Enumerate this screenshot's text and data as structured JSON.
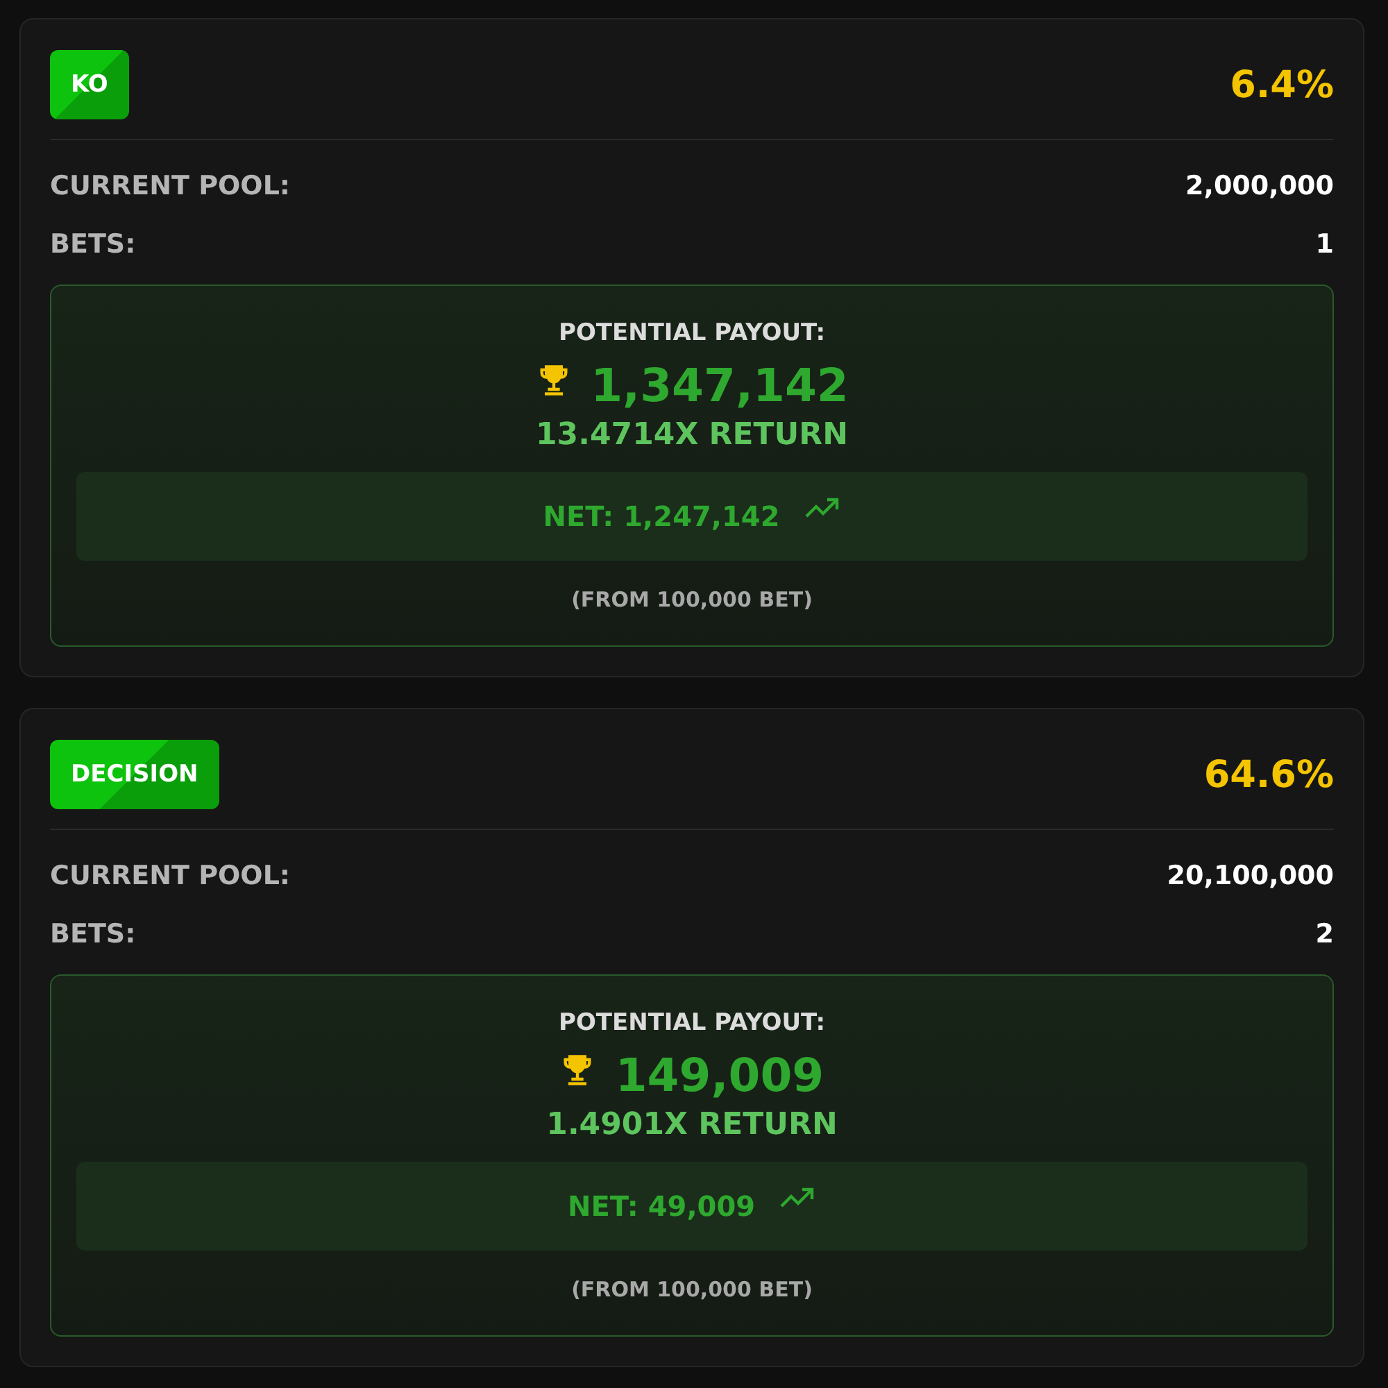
{
  "outcomes": [
    {
      "label": "KO",
      "percent": "6.4%",
      "pool_label": "CURRENT POOL:",
      "pool": "2,000,000",
      "bets_label": "BETS:",
      "bets": "1",
      "payout_label": "POTENTIAL PAYOUT:",
      "payout": "1,347,142",
      "return": "13.4714X RETURN",
      "net": "NET: 1,247,142",
      "basis": "(FROM 100,000 BET)"
    },
    {
      "label": "DECISION",
      "percent": "64.6%",
      "pool_label": "CURRENT POOL:",
      "pool": "20,100,000",
      "bets_label": "BETS:",
      "bets": "2",
      "payout_label": "POTENTIAL PAYOUT:",
      "payout": "149,009",
      "return": "1.4901X RETURN",
      "net": "NET: 49,009",
      "basis": "(FROM 100,000 BET)"
    }
  ]
}
